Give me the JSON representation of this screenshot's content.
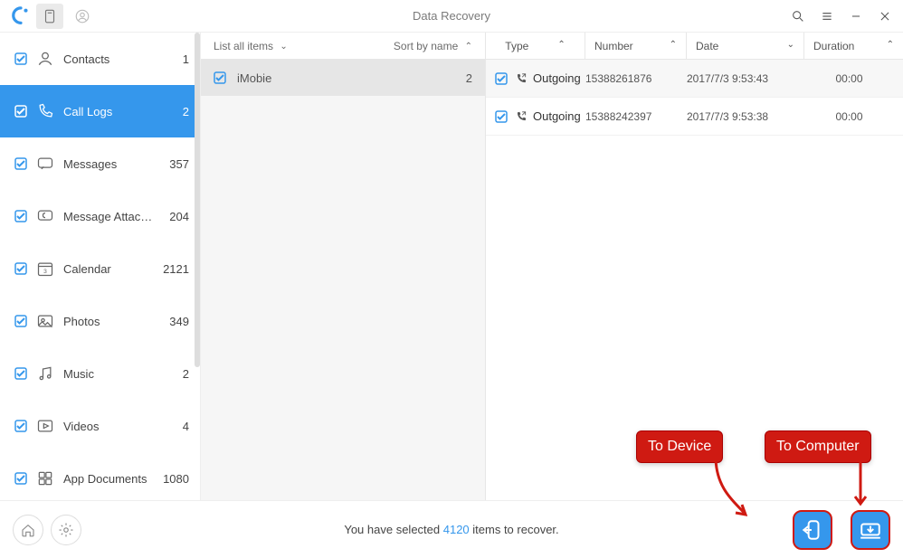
{
  "title": "Data Recovery",
  "sidebar": {
    "items": [
      {
        "label": "Contacts",
        "count": "1",
        "selected": false
      },
      {
        "label": "Call Logs",
        "count": "2",
        "selected": true
      },
      {
        "label": "Messages",
        "count": "357",
        "selected": false
      },
      {
        "label": "Message Attach...",
        "count": "204",
        "selected": false
      },
      {
        "label": "Calendar",
        "count": "2121",
        "selected": false
      },
      {
        "label": "Photos",
        "count": "349",
        "selected": false
      },
      {
        "label": "Music",
        "count": "2",
        "selected": false
      },
      {
        "label": "Videos",
        "count": "4",
        "selected": false
      },
      {
        "label": "App Documents",
        "count": "1080",
        "selected": false
      }
    ]
  },
  "mid": {
    "list_label": "List all items",
    "sort_label": "Sort by name",
    "items": [
      {
        "label": "iMobie",
        "count": "2"
      }
    ]
  },
  "detail": {
    "headers": {
      "type": "Type",
      "number": "Number",
      "date": "Date",
      "duration": "Duration"
    },
    "rows": [
      {
        "type": "Outgoing",
        "number": "15388261876",
        "date": "2017/7/3 9:53:43",
        "duration": "00:00"
      },
      {
        "type": "Outgoing",
        "number": "15388242397",
        "date": "2017/7/3 9:53:38",
        "duration": "00:00"
      }
    ]
  },
  "footer": {
    "pre": "You have selected ",
    "count": "4120",
    "post": " items to recover."
  },
  "callouts": {
    "to_device": "To Device",
    "to_computer": "To Computer"
  }
}
